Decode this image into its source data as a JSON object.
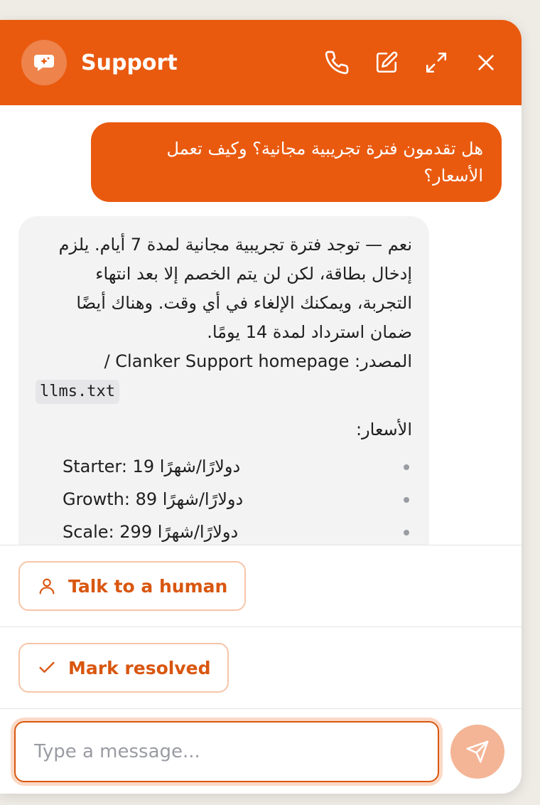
{
  "header": {
    "title": "Support",
    "icons": [
      "chat-bubble-sparkle-icon",
      "phone-icon",
      "edit-icon",
      "expand-icon",
      "close-icon"
    ]
  },
  "messages": {
    "user_message": "هل تقدمون فترة تجريبية مجانية؟ وكيف تعمل الأسعار؟",
    "bot_intro": "نعم — توجد فترة تجريبية مجانية لمدة 7 أيام. يلزم إدخال بطاقة، لكن لن يتم الخصم إلا بعد انتهاء التجربة، ويمكنك الإلغاء في أي وقت. وهناك أيضًا ضمان استرداد لمدة 14 يومًا.",
    "source_label": "المصدر: Clanker Support homepage /",
    "source_code": "llms.txt",
    "prices_label": "الأسعار:",
    "prices": [
      "Starter: 19 دولارًا/شهرًا",
      "Growth: 89 دولارًا/شهرًا",
      "Scale: 299 دولارًا/شهرًا"
    ]
  },
  "actions": {
    "talk_human_label": "Talk to a human",
    "mark_resolved_label": "Mark resolved"
  },
  "composer": {
    "placeholder": "Type a message..."
  },
  "colors": {
    "brand": "#e95a0f",
    "send_button": "#f4b596"
  }
}
